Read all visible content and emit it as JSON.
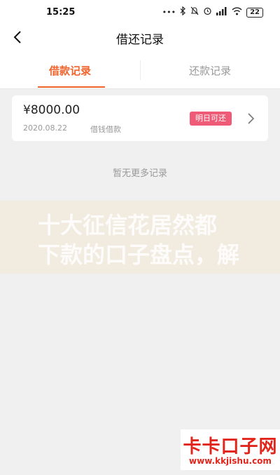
{
  "status_bar": {
    "time": "15:25",
    "battery": "22",
    "icons": [
      "dots-icon",
      "bluetooth-icon",
      "mute-icon",
      "alarm-icon",
      "signal-icon",
      "wifi-icon",
      "battery-icon"
    ]
  },
  "nav": {
    "title": "借还记录"
  },
  "tabs": [
    {
      "label": "借款记录",
      "active": true
    },
    {
      "label": "还款记录",
      "active": false
    }
  ],
  "records": [
    {
      "amount": "¥8000.00",
      "date": "2020.08.22",
      "type": "借钱借款",
      "status": "明日可还"
    }
  ],
  "footer_note": "暂无更多记录",
  "watermark": {
    "line1": "十大征信花居然都",
    "line2": "下款的口子盘点，解"
  },
  "brand": {
    "name": "卡卡口子网",
    "url": "www.kkjishu.com"
  },
  "colors": {
    "accent": "#f0642d",
    "badge": "#ef5a76",
    "background": "#f0f0f0",
    "brand": "#e1251b"
  }
}
